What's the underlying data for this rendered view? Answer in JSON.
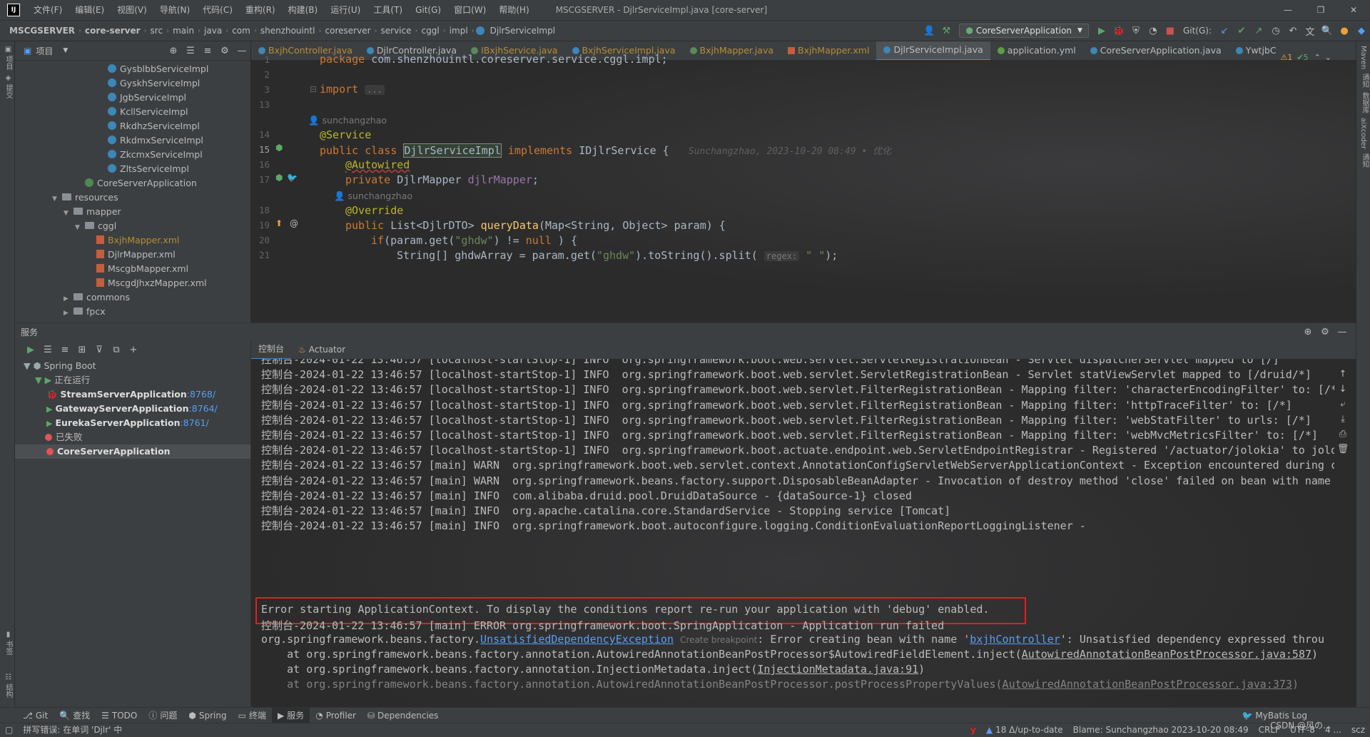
{
  "menubar": {
    "app_logo": "IJ",
    "items": [
      "文件(F)",
      "编辑(E)",
      "视图(V)",
      "导航(N)",
      "代码(C)",
      "重构(R)",
      "构建(B)",
      "运行(U)",
      "工具(T)",
      "Git(G)",
      "窗口(W)",
      "帮助(H)"
    ],
    "window_title": "MSCGSERVER - DjlrServiceImpl.java [core-server]"
  },
  "navbar": {
    "breadcrumbs": [
      "MSCGSERVER",
      "core-server",
      "src",
      "main",
      "java",
      "com",
      "shenzhouintl",
      "coreserver",
      "service",
      "cggl",
      "impl",
      "DjlrServiceImpl"
    ],
    "run_config": "CoreServerApplication",
    "git_label": "Git(G):"
  },
  "project": {
    "title": "项目",
    "tree": [
      {
        "label": "GysblbbServiceImpl",
        "icon": "class",
        "indent": 7,
        "vcs": false
      },
      {
        "label": "GyskhServiceImpl",
        "icon": "class",
        "indent": 7,
        "vcs": false
      },
      {
        "label": "JgbServiceImpl",
        "icon": "class",
        "indent": 7,
        "vcs": false
      },
      {
        "label": "KcllServiceImpl",
        "icon": "class",
        "indent": 7,
        "vcs": false
      },
      {
        "label": "RkdhzServiceImpl",
        "icon": "class",
        "indent": 7,
        "vcs": false
      },
      {
        "label": "RkdmxServiceImpl",
        "icon": "class",
        "indent": 7,
        "vcs": false
      },
      {
        "label": "ZkcmxServiceImpl",
        "icon": "class",
        "indent": 7,
        "vcs": false
      },
      {
        "label": "ZltsServiceImpl",
        "icon": "class",
        "indent": 7,
        "vcs": false
      },
      {
        "label": "CoreServerApplication",
        "icon": "spring",
        "indent": 5,
        "vcs": false
      },
      {
        "label": "resources",
        "icon": "folder",
        "indent": 3,
        "vcs": false,
        "arrow": "down"
      },
      {
        "label": "mapper",
        "icon": "folder",
        "indent": 4,
        "vcs": false,
        "arrow": "down"
      },
      {
        "label": "cggl",
        "icon": "folder",
        "indent": 5,
        "vcs": false,
        "arrow": "down"
      },
      {
        "label": "BxjhMapper.xml",
        "icon": "xml",
        "indent": 6,
        "vcs": true
      },
      {
        "label": "DjlrMapper.xml",
        "icon": "xml",
        "indent": 6,
        "vcs": false
      },
      {
        "label": "MscgbMapper.xml",
        "icon": "xml",
        "indent": 6,
        "vcs": false
      },
      {
        "label": "MscgdJhxzMapper.xml",
        "icon": "xml",
        "indent": 6,
        "vcs": false
      },
      {
        "label": "commons",
        "icon": "folder",
        "indent": 4,
        "vcs": false,
        "arrow": "right"
      },
      {
        "label": "fpcx",
        "icon": "folder",
        "indent": 4,
        "vcs": false,
        "arrow": "right"
      }
    ]
  },
  "tabs": [
    {
      "label": "BxjhController.java",
      "kind": "class",
      "vcs": true,
      "active": false
    },
    {
      "label": "DjlrController.java",
      "kind": "class",
      "vcs": false,
      "active": false
    },
    {
      "label": "IBxjhService.java",
      "kind": "i",
      "vcs": true,
      "active": false
    },
    {
      "label": "BxjhServiceImpl.java",
      "kind": "class",
      "vcs": true,
      "active": false
    },
    {
      "label": "BxjhMapper.java",
      "kind": "i",
      "vcs": true,
      "active": false
    },
    {
      "label": "BxjhMapper.xml",
      "kind": "xml",
      "vcs": true,
      "active": false
    },
    {
      "label": "DjlrServiceImpl.java",
      "kind": "class",
      "vcs": false,
      "active": true
    },
    {
      "label": "application.yml",
      "kind": "yml",
      "vcs": false,
      "active": false
    },
    {
      "label": "CoreServerApplication.java",
      "kind": "class",
      "vcs": false,
      "active": false
    },
    {
      "label": "YwtjbC",
      "kind": "class",
      "vcs": false,
      "active": false
    }
  ],
  "editor": {
    "inspection_warnings": "⚠1",
    "inspection_ok": "✔5",
    "author_hint_1": "sunchangzhao",
    "author_hint_2": "sunchangzhao",
    "blame": "Sunchangzhao, 2023-10-20 08:49 • 优化",
    "regex_hint": "regex:",
    "line_numbers": [
      "1",
      "2",
      "3",
      "13",
      "14",
      "15",
      "16",
      "17",
      "18",
      "19",
      "20",
      "21"
    ]
  },
  "services": {
    "title": "服务",
    "tree": [
      {
        "label": "Spring Boot",
        "indent": 1,
        "kind": "group"
      },
      {
        "label": "正在运行",
        "indent": 2,
        "kind": "running-group"
      },
      {
        "label": "StreamServerApplication",
        "port": ":8768/",
        "indent": 3,
        "kind": "debug"
      },
      {
        "label": "GatewayServerApplication",
        "port": ":8764/",
        "indent": 3,
        "kind": "run"
      },
      {
        "label": "EurekaServerApplication",
        "port": ":8761/",
        "indent": 3,
        "kind": "run"
      },
      {
        "label": "已失败",
        "indent": 2,
        "kind": "failed-group"
      },
      {
        "label": "CoreServerApplication",
        "port": "",
        "indent": 3,
        "kind": "failed"
      }
    ]
  },
  "console": {
    "tabs": [
      "控制台",
      "Actuator"
    ],
    "lines": [
      "控制台-2024-01-22 13:46:57 [localhost-startStop-1] INFO  org.springframework.boot.web.servlet.ServletRegistrationBean - Servlet dispatcherServlet mapped to [/]",
      "控制台-2024-01-22 13:46:57 [localhost-startStop-1] INFO  org.springframework.boot.web.servlet.ServletRegistrationBean - Servlet statViewServlet mapped to [/druid/*]",
      "控制台-2024-01-22 13:46:57 [localhost-startStop-1] INFO  org.springframework.boot.web.servlet.FilterRegistrationBean - Mapping filter: 'characterEncodingFilter' to: [/*",
      "控制台-2024-01-22 13:46:57 [localhost-startStop-1] INFO  org.springframework.boot.web.servlet.FilterRegistrationBean - Mapping filter: 'httpTraceFilter' to: [/*]",
      "控制台-2024-01-22 13:46:57 [localhost-startStop-1] INFO  org.springframework.boot.web.servlet.FilterRegistrationBean - Mapping filter: 'webStatFilter' to urls: [/*]",
      "控制台-2024-01-22 13:46:57 [localhost-startStop-1] INFO  org.springframework.boot.web.servlet.FilterRegistrationBean - Mapping filter: 'webMvcMetricsFilter' to: [/*]",
      "控制台-2024-01-22 13:46:57 [localhost-startStop-1] INFO  org.springframework.boot.actuate.endpoint.web.ServletEndpointRegistrar - Registered '/actuator/jolokia' to jolo",
      "控制台-2024-01-22 13:46:57 [main] WARN  org.springframework.boot.web.servlet.context.AnnotationConfigServletWebServerApplicationContext - Exception encountered during c",
      "控制台-2024-01-22 13:46:57 [main] WARN  org.springframework.beans.factory.support.DisposableBeanAdapter - Invocation of destroy method 'close' failed on bean with name",
      "控制台-2024-01-22 13:46:57 [main] INFO  com.alibaba.druid.pool.DruidDataSource - {dataSource-1} closed",
      "控制台-2024-01-22 13:46:57 [main] INFO  org.apache.catalina.core.StandardService - Stopping service [Tomcat]",
      "控制台-2024-01-22 13:46:57 [main] INFO  org.springframework.boot.autoconfigure.logging.ConditionEvaluationReportLoggingListener -"
    ],
    "error_line": "Error starting ApplicationContext. To display the conditions report re-run your application with 'debug' enabled.",
    "error_run_failed": "控制台-2024-01-22 13:46:57 [main] ERROR org.springframework.boot.SpringApplication - Application run failed",
    "exception_prefix": "org.springframework.beans.factory.",
    "exception_link": "UnsatisfiedDependencyException",
    "create_breakpoint": "Create breakpoint",
    "exception_msg": ": Error creating bean with name '",
    "bean_link": "bxjhController",
    "exception_tail": "': Unsatisfied dependency expressed throu",
    "stack1_prefix": "    at org.springframework.beans.factory.annotation.AutowiredAnnotationBeanPostProcessor$AutowiredFieldElement.inject(",
    "stack1_link": "AutowiredAnnotationBeanPostProcessor.java:587",
    "stack2_prefix": "    at org.springframework.beans.factory.annotation.InjectionMetadata.inject(",
    "stack2_link": "InjectionMetadata.java:91",
    "stack3_prefix": "    at org.springframework.beans.factory.annotation.AutowiredAnnotationBeanPostProcessor.postProcessPropertyValues(",
    "stack3_link": "AutowiredAnnotationBeanPostProcessor.java:373"
  },
  "bottom_tools": [
    "Git",
    "查找",
    "TODO",
    "问题",
    "Spring",
    "终端",
    "服务",
    "Profiler",
    "Dependencies"
  ],
  "bottom_right": "MyBatis Log",
  "status": {
    "left": "拼写错误: 在单词 'Djlr' 中",
    "vcs": "18 Δ/up-to-date",
    "blame": "Blame: Sunchangzhao 2023-10-20 08:49",
    "line_sep": "CRLF",
    "encoding": "UTF-8",
    "indent": "4 ...",
    "user": "scz"
  },
  "watermark": "CSDN @风の..."
}
